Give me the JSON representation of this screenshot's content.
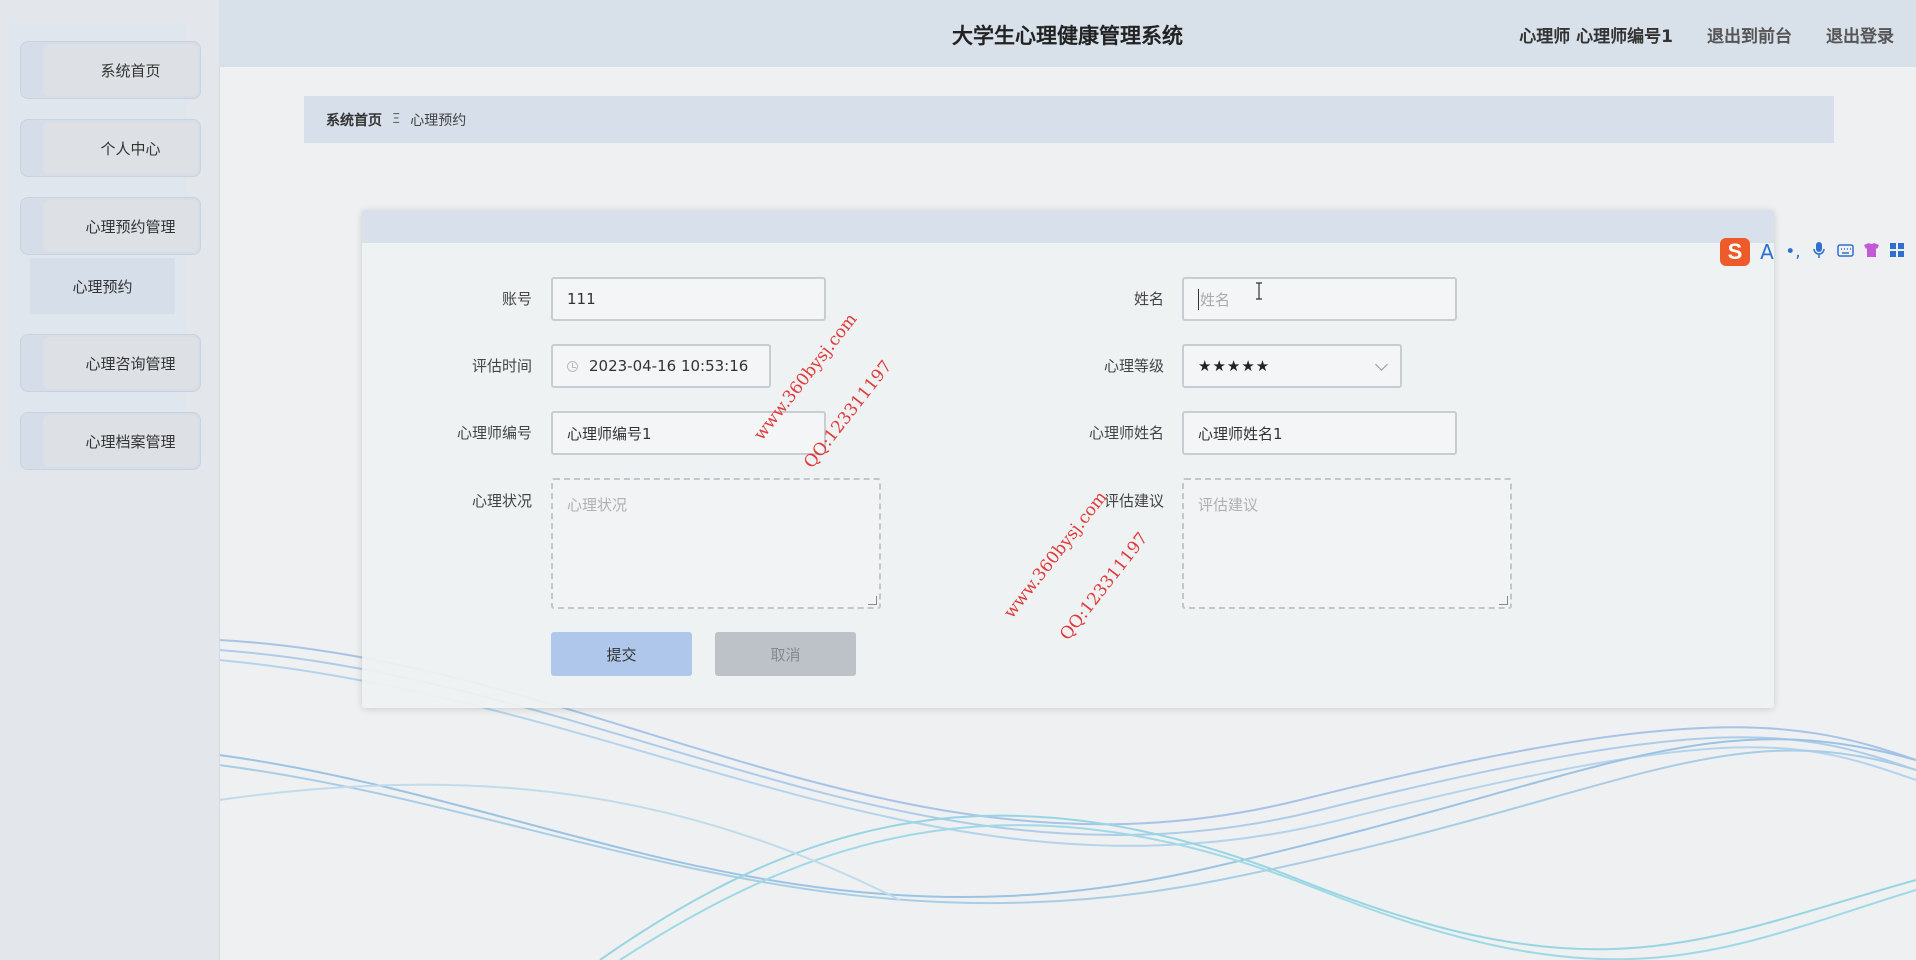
{
  "header": {
    "title": "大学生心理健康管理系统",
    "user_label": "心理师 心理师编号1",
    "to_frontend": "退出到前台",
    "logout": "退出登录"
  },
  "sidebar": {
    "items": [
      {
        "label": "系统首页"
      },
      {
        "label": "个人中心"
      },
      {
        "label": "心理预约管理"
      },
      {
        "label": "心理咨询管理"
      },
      {
        "label": "心理档案管理"
      }
    ],
    "submenu": {
      "label": "心理预约"
    }
  },
  "breadcrumb": {
    "home": "系统首页",
    "separator": "Ξ",
    "current": "心理预约"
  },
  "form": {
    "account": {
      "label": "账号",
      "value": "111"
    },
    "name": {
      "label": "姓名",
      "placeholder": "姓名"
    },
    "eval_time": {
      "label": "评估时间",
      "value": "2023-04-16 10:53:16"
    },
    "level": {
      "label": "心理等级",
      "value": "★★★★★"
    },
    "psych_id": {
      "label": "心理师编号",
      "value": "心理师编号1"
    },
    "psych_name": {
      "label": "心理师姓名",
      "value": "心理师姓名1"
    },
    "status": {
      "label": "心理状况",
      "placeholder": "心理状况"
    },
    "advice": {
      "label": "评估建议",
      "placeholder": "评估建议"
    },
    "submit_label": "提交",
    "cancel_label": "取消"
  },
  "watermarks": [
    {
      "site": "www.360bysj.com",
      "qq": "QQ:123311197"
    },
    {
      "site": "www.360bysj.com",
      "qq": "QQ:123311197"
    }
  ],
  "ime_toolbar": {
    "logo": "S",
    "text_icon": "A"
  },
  "colors": {
    "header_bg": "#d8e0ea",
    "submit_bg": "#aec7ea",
    "cancel_bg": "#bcc2c8",
    "watermark": "#e03a3a",
    "ime_logo": "#ef5a2a"
  }
}
